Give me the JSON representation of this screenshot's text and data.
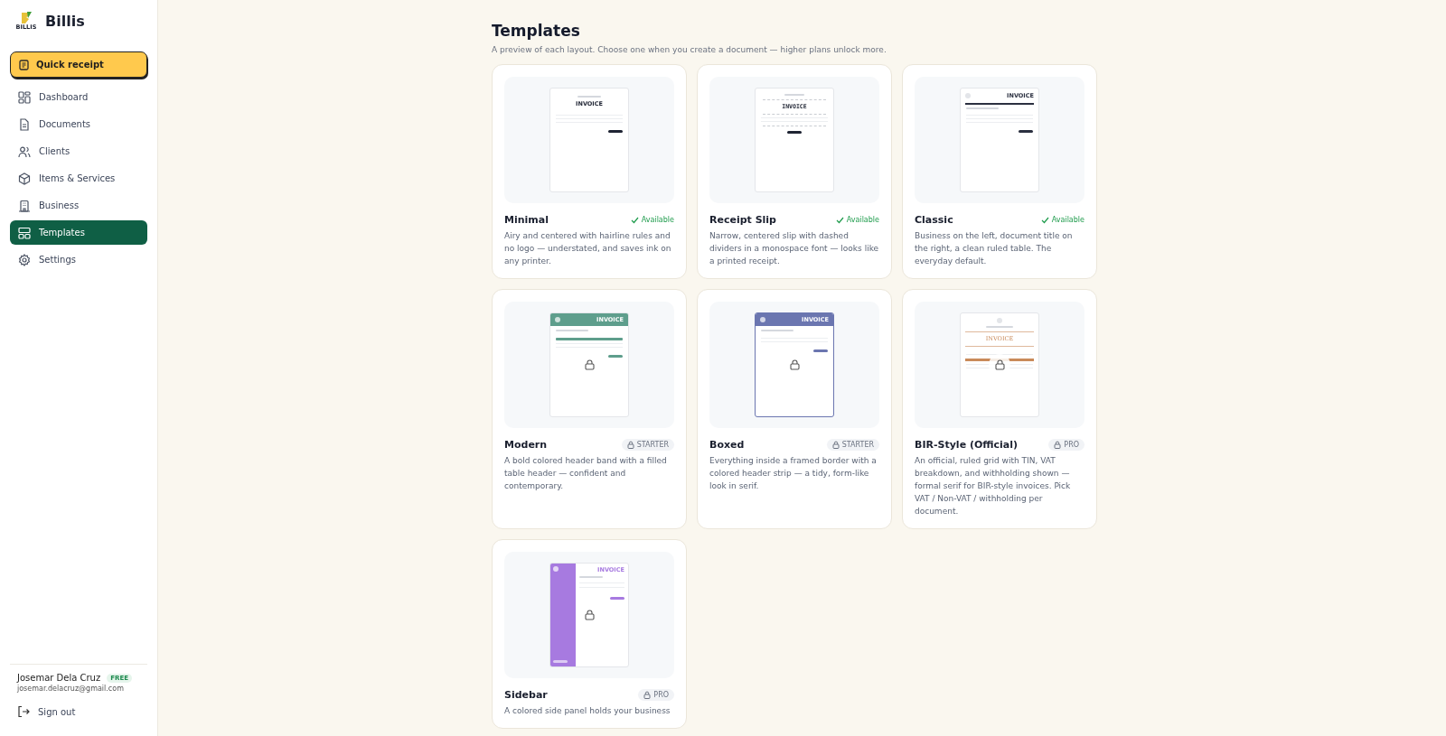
{
  "app": {
    "name": "Billis",
    "logo_text": "BILLIS"
  },
  "quick_action": {
    "label": "Quick receipt"
  },
  "nav": [
    {
      "label": "Dashboard",
      "selected": false
    },
    {
      "label": "Documents",
      "selected": false
    },
    {
      "label": "Clients",
      "selected": false
    },
    {
      "label": "Items & Services",
      "selected": false
    },
    {
      "label": "Business",
      "selected": false
    },
    {
      "label": "Templates",
      "selected": true
    },
    {
      "label": "Settings",
      "selected": false
    }
  ],
  "user": {
    "name": "Josemar Dela Cruz",
    "plan": "FREE",
    "email": "josemar.delacruz@gmail.com"
  },
  "sign_out": {
    "label": "Sign out"
  },
  "page": {
    "title": "Templates",
    "subtitle": "A preview of each layout. Choose one when you create a document — higher plans unlock more."
  },
  "templates": [
    {
      "kind": "minimal",
      "name": "Minimal",
      "badge": "Available",
      "locked": false,
      "preview_title": "INVOICE",
      "color": "#1f2433",
      "description": "Airy and centered with hairline rules and no logo — understated, and saves ink on any printer."
    },
    {
      "kind": "receipt",
      "name": "Receipt Slip",
      "badge": "Available",
      "locked": false,
      "preview_title": "INVOICE",
      "color": "#1f2433",
      "description": "Narrow, centered slip with dashed dividers in a monospace font — looks like a printed receipt."
    },
    {
      "kind": "classic",
      "name": "Classic",
      "badge": "Available",
      "locked": false,
      "preview_title": "INVOICE",
      "color": "#2b3040",
      "description": "Business on the left, document title on the right, a clean ruled table. The everyday default."
    },
    {
      "kind": "modern",
      "name": "Modern",
      "badge": "STARTER",
      "locked": true,
      "preview_title": "INVOICE",
      "color": "#5e9e8c",
      "description": "A bold colored header band with a filled table header — confident and contemporary."
    },
    {
      "kind": "boxed",
      "name": "Boxed",
      "badge": "STARTER",
      "locked": true,
      "preview_title": "INVOICE",
      "color": "#6b76b0",
      "description": "Everything inside a framed border with a colored header strip — a tidy, form-like look in serif."
    },
    {
      "kind": "bir",
      "name": "BIR-Style (Official)",
      "badge": "PRO",
      "locked": true,
      "preview_title": "INVOICE",
      "color": "#c98a5a",
      "description": "An official, ruled grid with TIN, VAT breakdown, and withholding shown — formal serif for BIR-style invoices. Pick VAT / Non-VAT / withholding per document."
    },
    {
      "kind": "sidebar",
      "name": "Sidebar",
      "badge": "PRO",
      "locked": true,
      "preview_title": "INVOICE",
      "color": "#a77ae0",
      "description": "A colored side panel holds your business"
    }
  ]
}
